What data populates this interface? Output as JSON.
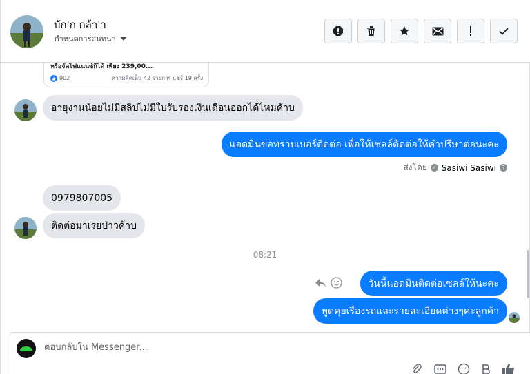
{
  "contact": {
    "name": "บัก'ก กล้า'า",
    "subtitle": "กำหนดการสนทนา"
  },
  "header_actions": [
    {
      "name": "spam-icon"
    },
    {
      "name": "trash-icon"
    },
    {
      "name": "star-icon"
    },
    {
      "name": "envelope-icon"
    },
    {
      "name": "exclamation-icon"
    },
    {
      "name": "checkmark-icon"
    }
  ],
  "shared_post": {
    "text": "หรือจัดไฟแนนซ์ก็ได้ เพียง 239,00...",
    "likes": "902",
    "stats": "ความคิดเห็น 42 รายการ แชร์ 19 ครั้ง"
  },
  "messages": {
    "m1": "อายุงานน้อยไม่มีสลิปไม่มีใบรับรองเงินเดือนออกได้ไหมค้าบ",
    "m2": "แอดมินขอทราบเบอร์ติดต่อ เพื่อให้เซลล์ติดต่อให้คำปรึษาต่อนะคะ",
    "m3": "0979807005",
    "m4": "ติดต่อมาเรยป่าวค้าบ",
    "m5": "วันนี้แอดมินติดต่อเซลล์ให้นะคะ",
    "m6": "พูดคุยเรื่องรถและรายละเอียดต่างๆค่ะลูกค้า"
  },
  "sent_by": {
    "prefix": "ส่งโดย",
    "name": "Sasiwi Sasiwi",
    "help": "?"
  },
  "time_divider": "08:21",
  "composer": {
    "placeholder": "ตอบกลับใน Messenger..."
  },
  "colors": {
    "outgoing_bubble": "#0a7cff",
    "incoming_bubble": "#e4e6eb",
    "like_blue": "#1877f2"
  }
}
